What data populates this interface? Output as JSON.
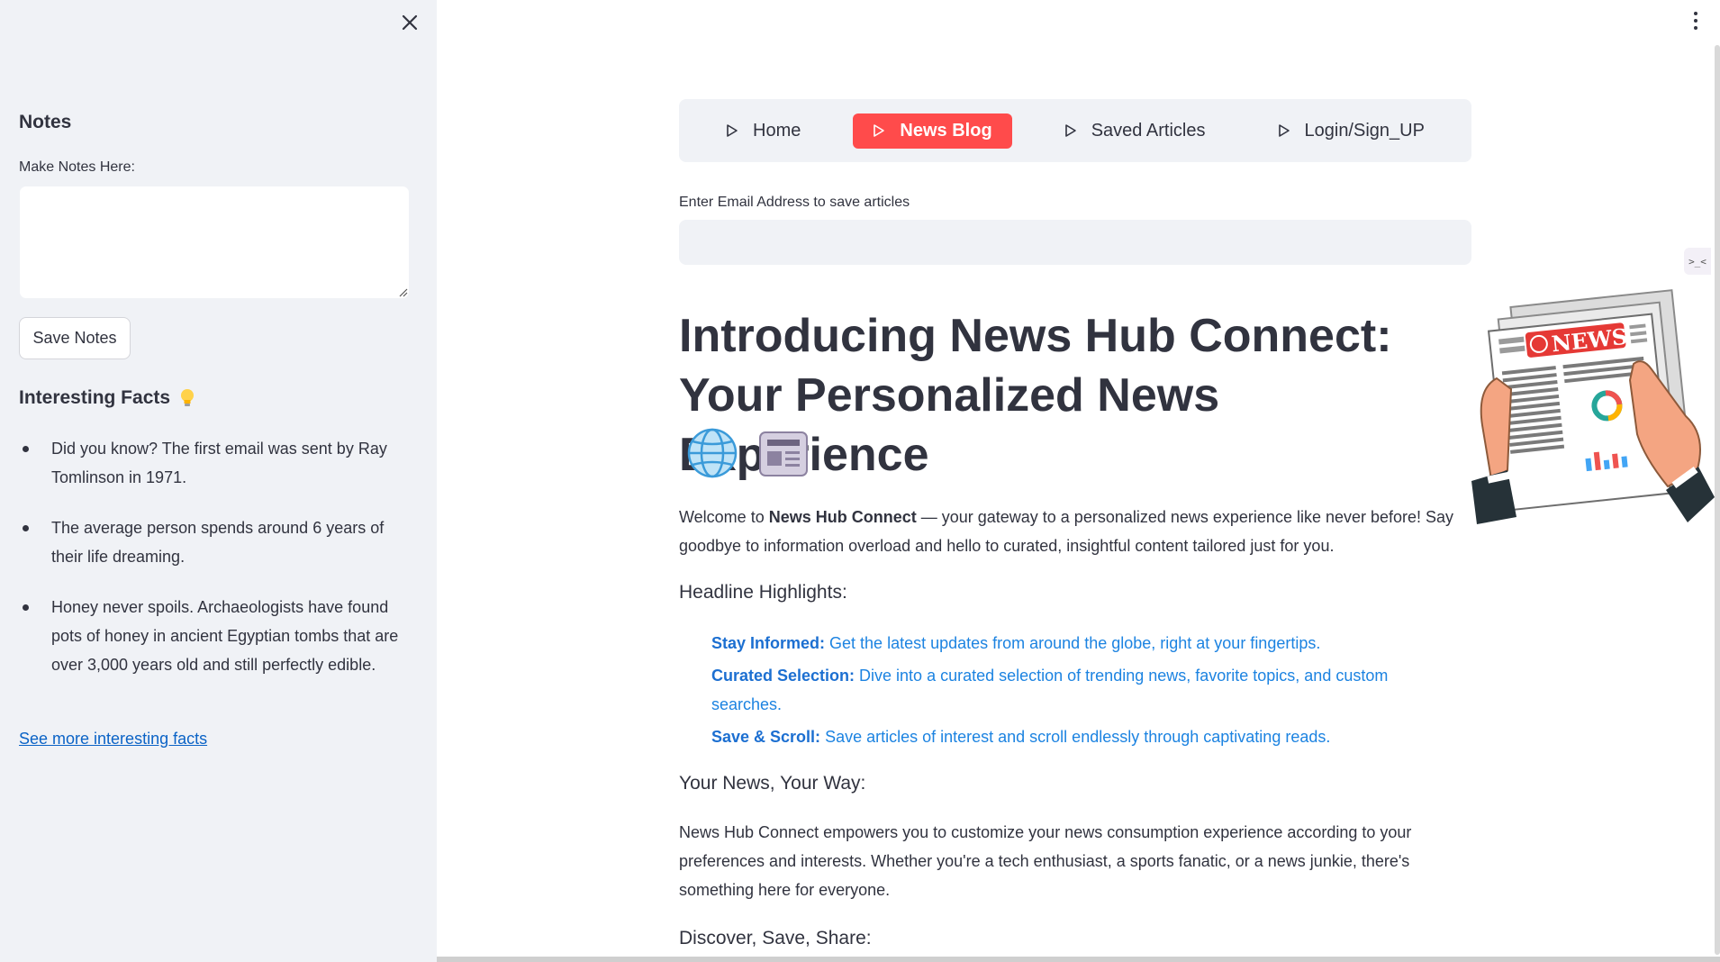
{
  "sidebar": {
    "notes_title": "Notes",
    "notes_label": "Make Notes Here:",
    "notes_value": "",
    "save_button": "Save Notes",
    "facts_title": "Interesting Facts",
    "facts_icon": "lightbulb-icon",
    "facts": [
      "Did you know? The first email was sent by Ray Tomlinson in 1971.",
      "The average person spends around 6 years of their life dreaming.",
      "Honey never spoils. Archaeologists have found pots of honey in ancient Egyptian tombs that are over 3,000 years old and still perfectly edible."
    ],
    "more_link": "See more interesting facts"
  },
  "nav": {
    "items": [
      {
        "label": "Home",
        "active": false
      },
      {
        "label": "News Blog",
        "active": true
      },
      {
        "label": "Saved Articles",
        "active": false
      },
      {
        "label": "Login/Sign_UP",
        "active": false
      }
    ],
    "active_color": "#ff4b4b"
  },
  "email": {
    "label": "Enter Email Address to save articles",
    "value": ""
  },
  "hero": {
    "title": "Introducing News Hub Connect: Your Personalized News Experience",
    "icons": [
      "globe-icon",
      "newspaper-icon"
    ]
  },
  "welcome": {
    "prefix": "Welcome to ",
    "brand": "News Hub Connect",
    "suffix": " — your gateway to a personalized news experience like never before! Say goodbye to information overload and hello to curated, insightful content tailored just for you."
  },
  "headline_highlights": {
    "heading": "Headline Highlights:",
    "items": [
      {
        "title": "Stay Informed:",
        "text": " Get the latest updates from around the globe, right at your fingertips."
      },
      {
        "title": "Curated Selection:",
        "text": " Dive into a curated selection of trending news, favorite topics, and custom searches."
      },
      {
        "title": "Save & Scroll:",
        "text": " Save articles of interest and scroll endlessly through captivating reads."
      }
    ]
  },
  "your_news": {
    "heading": "Your News, Your Way:",
    "text": "News Hub Connect empowers you to customize your news consumption experience according to your preferences and interests. Whether you're a tech enthusiast, a sports fanatic, or a news junkie, there's something here for everyone."
  },
  "discover": {
    "heading": "Discover, Save, Share:"
  },
  "illustration": {
    "banner_text": "NEWS"
  },
  "widget": {
    "label": ">_<"
  }
}
